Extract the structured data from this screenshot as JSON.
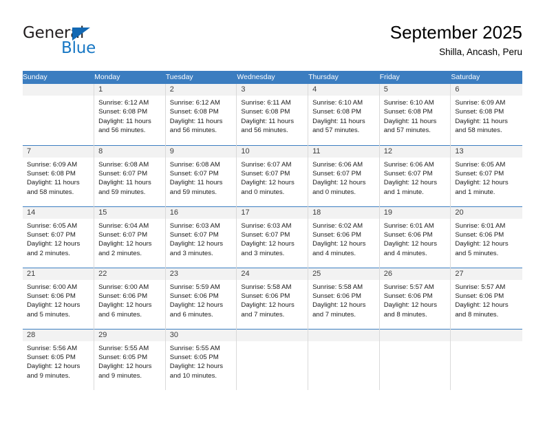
{
  "logo": {
    "word_top": "General",
    "word_bottom": "Blue",
    "triangle_color": "#1268b3",
    "blue_color": "#1777c4"
  },
  "header": {
    "title": "September 2025",
    "subtitle": "Shilla, Ancash, Peru",
    "header_bg": "#3b7dc0",
    "band_bg": "#f2f2f2"
  },
  "weekday_headers": [
    "Sunday",
    "Monday",
    "Tuesday",
    "Wednesday",
    "Thursday",
    "Friday",
    "Saturday"
  ],
  "weeks": [
    [
      {
        "day": "",
        "lines": []
      },
      {
        "day": "1",
        "lines": [
          "Sunrise: 6:12 AM",
          "Sunset: 6:08 PM",
          "Daylight: 11 hours",
          "and 56 minutes."
        ]
      },
      {
        "day": "2",
        "lines": [
          "Sunrise: 6:12 AM",
          "Sunset: 6:08 PM",
          "Daylight: 11 hours",
          "and 56 minutes."
        ]
      },
      {
        "day": "3",
        "lines": [
          "Sunrise: 6:11 AM",
          "Sunset: 6:08 PM",
          "Daylight: 11 hours",
          "and 56 minutes."
        ]
      },
      {
        "day": "4",
        "lines": [
          "Sunrise: 6:10 AM",
          "Sunset: 6:08 PM",
          "Daylight: 11 hours",
          "and 57 minutes."
        ]
      },
      {
        "day": "5",
        "lines": [
          "Sunrise: 6:10 AM",
          "Sunset: 6:08 PM",
          "Daylight: 11 hours",
          "and 57 minutes."
        ]
      },
      {
        "day": "6",
        "lines": [
          "Sunrise: 6:09 AM",
          "Sunset: 6:08 PM",
          "Daylight: 11 hours",
          "and 58 minutes."
        ]
      }
    ],
    [
      {
        "day": "7",
        "lines": [
          "Sunrise: 6:09 AM",
          "Sunset: 6:08 PM",
          "Daylight: 11 hours",
          "and 58 minutes."
        ]
      },
      {
        "day": "8",
        "lines": [
          "Sunrise: 6:08 AM",
          "Sunset: 6:07 PM",
          "Daylight: 11 hours",
          "and 59 minutes."
        ]
      },
      {
        "day": "9",
        "lines": [
          "Sunrise: 6:08 AM",
          "Sunset: 6:07 PM",
          "Daylight: 11 hours",
          "and 59 minutes."
        ]
      },
      {
        "day": "10",
        "lines": [
          "Sunrise: 6:07 AM",
          "Sunset: 6:07 PM",
          "Daylight: 12 hours",
          "and 0 minutes."
        ]
      },
      {
        "day": "11",
        "lines": [
          "Sunrise: 6:06 AM",
          "Sunset: 6:07 PM",
          "Daylight: 12 hours",
          "and 0 minutes."
        ]
      },
      {
        "day": "12",
        "lines": [
          "Sunrise: 6:06 AM",
          "Sunset: 6:07 PM",
          "Daylight: 12 hours",
          "and 1 minute."
        ]
      },
      {
        "day": "13",
        "lines": [
          "Sunrise: 6:05 AM",
          "Sunset: 6:07 PM",
          "Daylight: 12 hours",
          "and 1 minute."
        ]
      }
    ],
    [
      {
        "day": "14",
        "lines": [
          "Sunrise: 6:05 AM",
          "Sunset: 6:07 PM",
          "Daylight: 12 hours",
          "and 2 minutes."
        ]
      },
      {
        "day": "15",
        "lines": [
          "Sunrise: 6:04 AM",
          "Sunset: 6:07 PM",
          "Daylight: 12 hours",
          "and 2 minutes."
        ]
      },
      {
        "day": "16",
        "lines": [
          "Sunrise: 6:03 AM",
          "Sunset: 6:07 PM",
          "Daylight: 12 hours",
          "and 3 minutes."
        ]
      },
      {
        "day": "17",
        "lines": [
          "Sunrise: 6:03 AM",
          "Sunset: 6:07 PM",
          "Daylight: 12 hours",
          "and 3 minutes."
        ]
      },
      {
        "day": "18",
        "lines": [
          "Sunrise: 6:02 AM",
          "Sunset: 6:06 PM",
          "Daylight: 12 hours",
          "and 4 minutes."
        ]
      },
      {
        "day": "19",
        "lines": [
          "Sunrise: 6:01 AM",
          "Sunset: 6:06 PM",
          "Daylight: 12 hours",
          "and 4 minutes."
        ]
      },
      {
        "day": "20",
        "lines": [
          "Sunrise: 6:01 AM",
          "Sunset: 6:06 PM",
          "Daylight: 12 hours",
          "and 5 minutes."
        ]
      }
    ],
    [
      {
        "day": "21",
        "lines": [
          "Sunrise: 6:00 AM",
          "Sunset: 6:06 PM",
          "Daylight: 12 hours",
          "and 5 minutes."
        ]
      },
      {
        "day": "22",
        "lines": [
          "Sunrise: 6:00 AM",
          "Sunset: 6:06 PM",
          "Daylight: 12 hours",
          "and 6 minutes."
        ]
      },
      {
        "day": "23",
        "lines": [
          "Sunrise: 5:59 AM",
          "Sunset: 6:06 PM",
          "Daylight: 12 hours",
          "and 6 minutes."
        ]
      },
      {
        "day": "24",
        "lines": [
          "Sunrise: 5:58 AM",
          "Sunset: 6:06 PM",
          "Daylight: 12 hours",
          "and 7 minutes."
        ]
      },
      {
        "day": "25",
        "lines": [
          "Sunrise: 5:58 AM",
          "Sunset: 6:06 PM",
          "Daylight: 12 hours",
          "and 7 minutes."
        ]
      },
      {
        "day": "26",
        "lines": [
          "Sunrise: 5:57 AM",
          "Sunset: 6:06 PM",
          "Daylight: 12 hours",
          "and 8 minutes."
        ]
      },
      {
        "day": "27",
        "lines": [
          "Sunrise: 5:57 AM",
          "Sunset: 6:06 PM",
          "Daylight: 12 hours",
          "and 8 minutes."
        ]
      }
    ],
    [
      {
        "day": "28",
        "lines": [
          "Sunrise: 5:56 AM",
          "Sunset: 6:05 PM",
          "Daylight: 12 hours",
          "and 9 minutes."
        ]
      },
      {
        "day": "29",
        "lines": [
          "Sunrise: 5:55 AM",
          "Sunset: 6:05 PM",
          "Daylight: 12 hours",
          "and 9 minutes."
        ]
      },
      {
        "day": "30",
        "lines": [
          "Sunrise: 5:55 AM",
          "Sunset: 6:05 PM",
          "Daylight: 12 hours",
          "and 10 minutes."
        ]
      },
      {
        "day": "",
        "lines": []
      },
      {
        "day": "",
        "lines": []
      },
      {
        "day": "",
        "lines": []
      },
      {
        "day": "",
        "lines": []
      }
    ]
  ]
}
